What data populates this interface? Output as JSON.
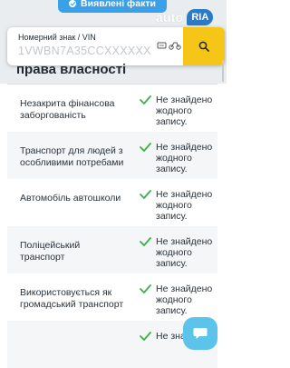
{
  "header": {
    "revealed_facts_label": "Виявлені факти",
    "logo_auto": "auto",
    "logo_ria": "RIA"
  },
  "search": {
    "label": "Номерний знак / VIN",
    "placeholder": "1VWBN7A35CCXXXXXX"
  },
  "section": {
    "title": "права власності"
  },
  "checks": [
    {
      "name": "Незакрита фінансова заборгованість",
      "status": "Не знайдено жодного запису."
    },
    {
      "name": "Транспорт для людей з особливими потребами",
      "status": "Не знайдено жодного запису."
    },
    {
      "name": "Автомобіль автошколи",
      "status": "Не знайдено жодного запису."
    },
    {
      "name": "Поліцейський транспорт",
      "status": "Не знайдено жодного запису."
    },
    {
      "name": "Використовується як громадський транспорт",
      "status": "Не знайдено жодного запису."
    },
    {
      "name": "",
      "status": "Не знайдено"
    }
  ],
  "colors": {
    "accent_yellow": "#f5c518",
    "accent_blue": "#3aa0e8",
    "check_green": "#3fae49",
    "chat_blue": "#5cc4ea"
  }
}
